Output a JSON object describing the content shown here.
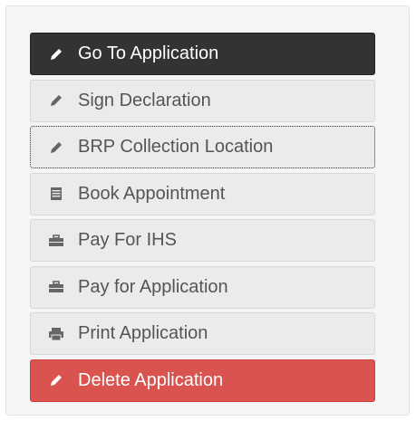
{
  "menu": {
    "items": [
      {
        "label": "Go To Application",
        "icon": "pencil-icon",
        "style": "dark"
      },
      {
        "label": "Sign Declaration",
        "icon": "pencil-icon",
        "style": "default"
      },
      {
        "label": "BRP Collection Location",
        "icon": "pencil-icon",
        "style": "focused"
      },
      {
        "label": "Book Appointment",
        "icon": "calendar-icon",
        "style": "default"
      },
      {
        "label": "Pay For IHS",
        "icon": "briefcase-icon",
        "style": "default"
      },
      {
        "label": "Pay for Application",
        "icon": "briefcase-icon",
        "style": "default"
      },
      {
        "label": "Print Application",
        "icon": "printer-icon",
        "style": "default"
      },
      {
        "label": "Delete Application",
        "icon": "pencil-icon",
        "style": "danger"
      }
    ]
  },
  "colors": {
    "dark_button": "#333333",
    "default_button": "#ebebeb",
    "danger_button": "#d9534f",
    "default_text": "#555555",
    "panel_background": "#f5f5f5"
  }
}
